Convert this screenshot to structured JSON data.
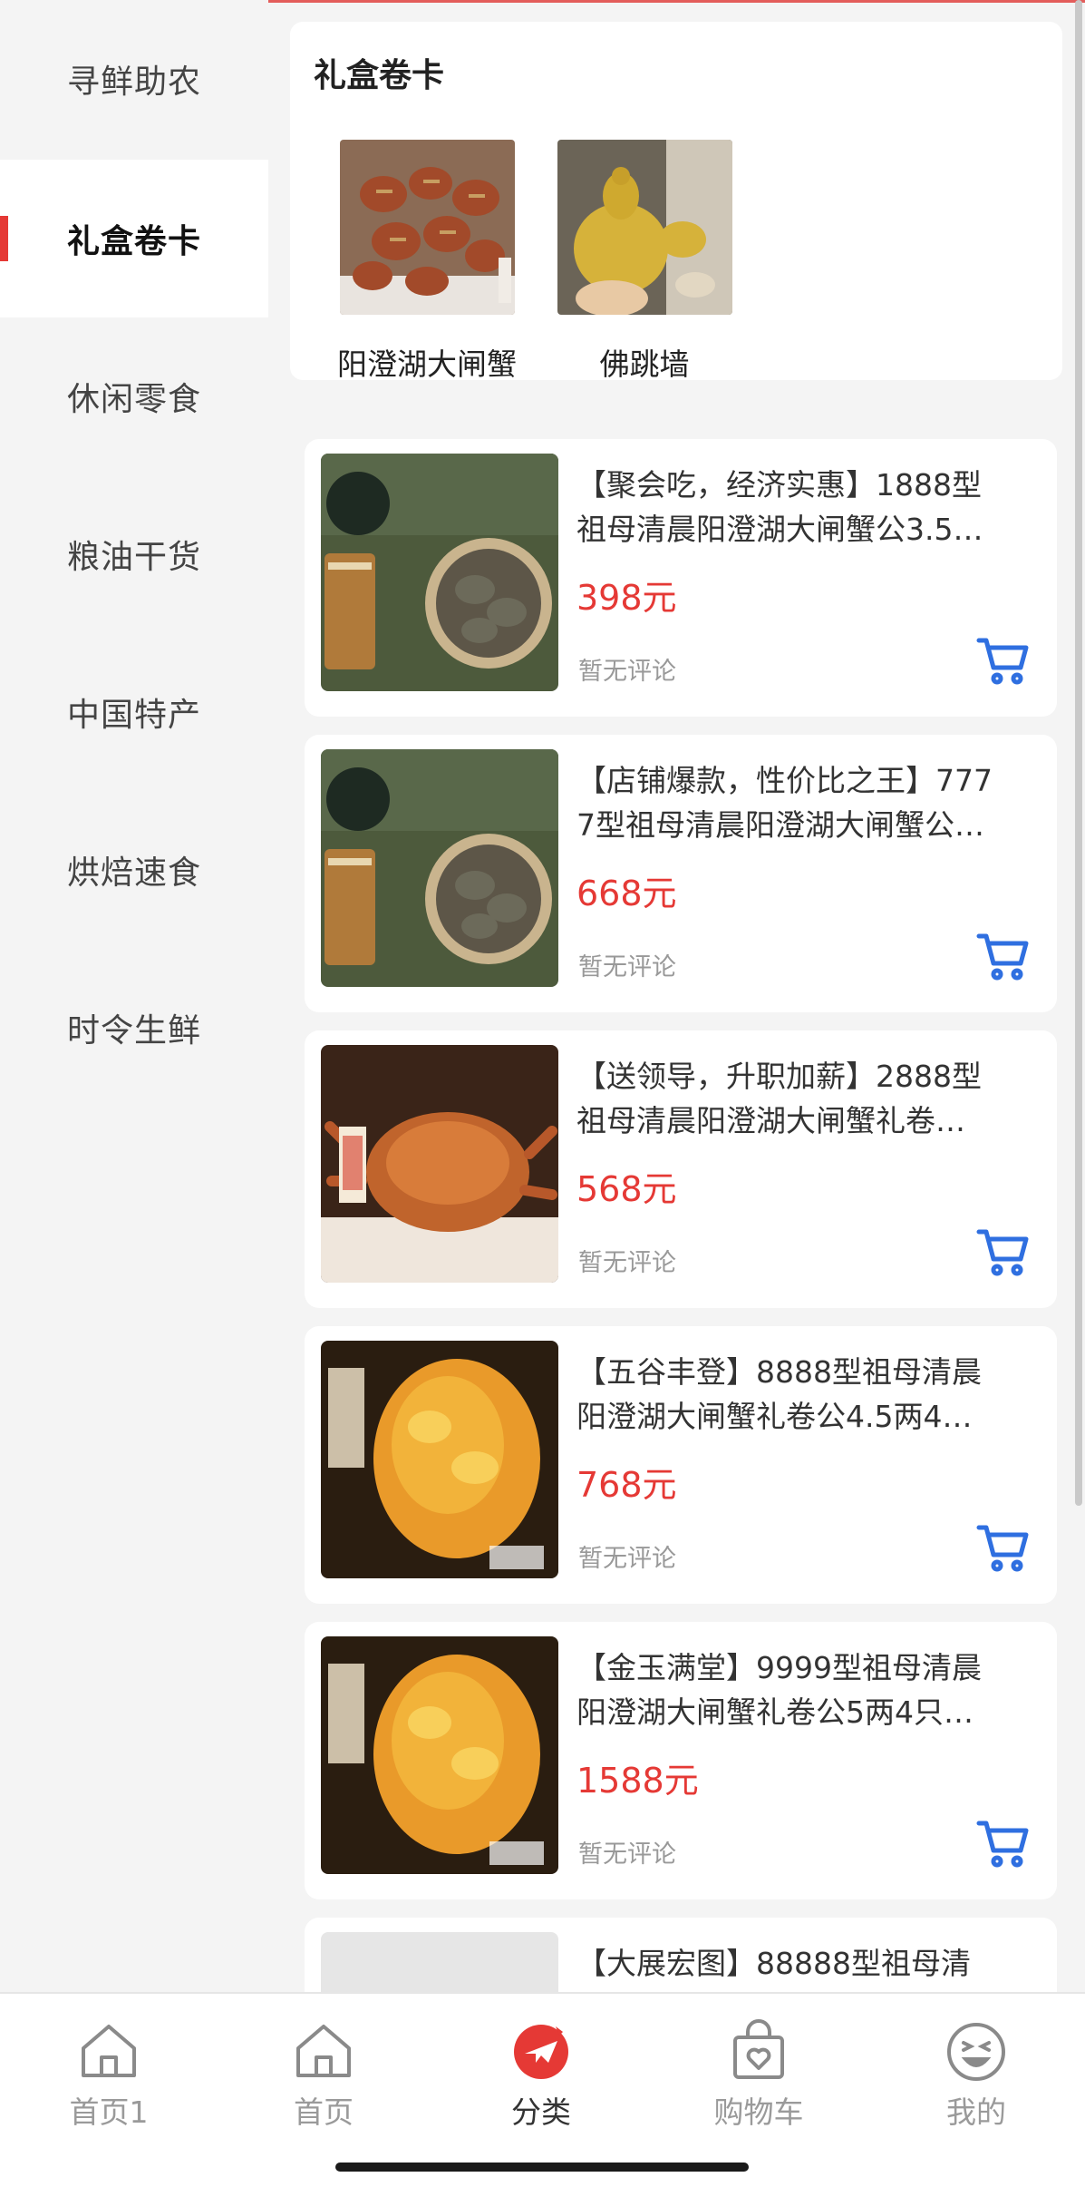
{
  "sidebar": {
    "items": [
      {
        "label": "寻鲜助农",
        "active": false
      },
      {
        "label": "礼盒卷卡",
        "active": true
      },
      {
        "label": "休闲零食",
        "active": false
      },
      {
        "label": "粮油干货",
        "active": false
      },
      {
        "label": "中国特产",
        "active": false
      },
      {
        "label": "烘焙速食",
        "active": false
      },
      {
        "label": "时令生鲜",
        "active": false
      }
    ]
  },
  "category": {
    "title": "礼盒卷卡",
    "tiles": [
      {
        "label": "阳澄湖大闸蟹"
      },
      {
        "label": "佛跳墙"
      }
    ]
  },
  "products": [
    {
      "title_line1": "【聚会吃，经济实惠】1888型",
      "title_line2": "祖母清晨阳澄湖大闸蟹公3.5…",
      "price": "398元",
      "review": "暂无评论"
    },
    {
      "title_line1": "【店铺爆款，性价比之王】777",
      "title_line2": "7型祖母清晨阳澄湖大闸蟹公…",
      "price": "668元",
      "review": "暂无评论"
    },
    {
      "title_line1": "【送领导，升职加薪】2888型",
      "title_line2": "祖母清晨阳澄湖大闸蟹礼卷…",
      "price": "568元",
      "review": "暂无评论"
    },
    {
      "title_line1": "【五谷丰登】8888型祖母清晨",
      "title_line2": "阳澄湖大闸蟹礼卷公4.5两4…",
      "price": "768元",
      "review": "暂无评论"
    },
    {
      "title_line1": "【金玉满堂】9999型祖母清晨",
      "title_line2": "阳澄湖大闸蟹礼卷公5两4只…",
      "price": "1588元",
      "review": "暂无评论"
    },
    {
      "title_line1": "【大展宏图】88888型祖母清",
      "title_line2": "",
      "price": "",
      "review": ""
    }
  ],
  "tabbar": {
    "tabs": [
      {
        "label": "首页1",
        "icon": "home-icon"
      },
      {
        "label": "首页",
        "icon": "home-icon"
      },
      {
        "label": "分类",
        "icon": "category-plane-icon",
        "active": true
      },
      {
        "label": "购物车",
        "icon": "shopping-bag-icon"
      },
      {
        "label": "我的",
        "icon": "smiley-face-icon"
      }
    ]
  },
  "colors": {
    "accent": "#e53935",
    "cart": "#2f6fe0",
    "muted": "#999999"
  }
}
